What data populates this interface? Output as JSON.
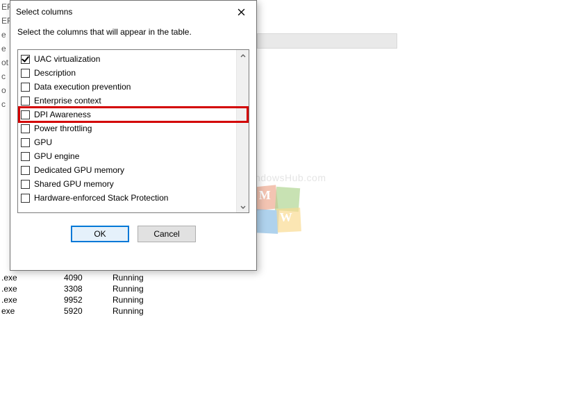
{
  "dialog": {
    "title": "Select columns",
    "instruction": "Select the columns that will appear in the table.",
    "items": [
      {
        "label": "UAC virtualization",
        "checked": true,
        "highlight": false
      },
      {
        "label": "Description",
        "checked": false,
        "highlight": false
      },
      {
        "label": "Data execution prevention",
        "checked": false,
        "highlight": false
      },
      {
        "label": "Enterprise context",
        "checked": false,
        "highlight": false
      },
      {
        "label": "DPI Awareness",
        "checked": false,
        "highlight": true
      },
      {
        "label": "Power throttling",
        "checked": false,
        "highlight": false
      },
      {
        "label": "GPU",
        "checked": false,
        "highlight": false
      },
      {
        "label": "GPU engine",
        "checked": false,
        "highlight": false
      },
      {
        "label": "Dedicated GPU memory",
        "checked": false,
        "highlight": false
      },
      {
        "label": "Shared GPU memory",
        "checked": false,
        "highlight": false
      },
      {
        "label": "Hardware-enforced Stack Protection",
        "checked": false,
        "highlight": false
      }
    ],
    "buttons": {
      "ok": "OK",
      "cancel": "Cancel"
    }
  },
  "background": {
    "left_fragments": [
      "EF",
      "",
      "EF",
      "",
      "e",
      "",
      "e",
      "",
      "ot",
      "",
      "c",
      "",
      "",
      "",
      "",
      "",
      "o",
      "",
      "c"
    ],
    "rows": [
      {
        "proc": ".exe",
        "pid": "4090",
        "status": "Running"
      },
      {
        "proc": ".exe",
        "pid": "3308",
        "status": "Running"
      },
      {
        "proc": ".exe",
        "pid": "9952",
        "status": "Running"
      },
      {
        "proc": "exe",
        "pid": "5920",
        "status": "Running"
      }
    ]
  },
  "watermark": {
    "text": "MyWindowsHub.com"
  }
}
